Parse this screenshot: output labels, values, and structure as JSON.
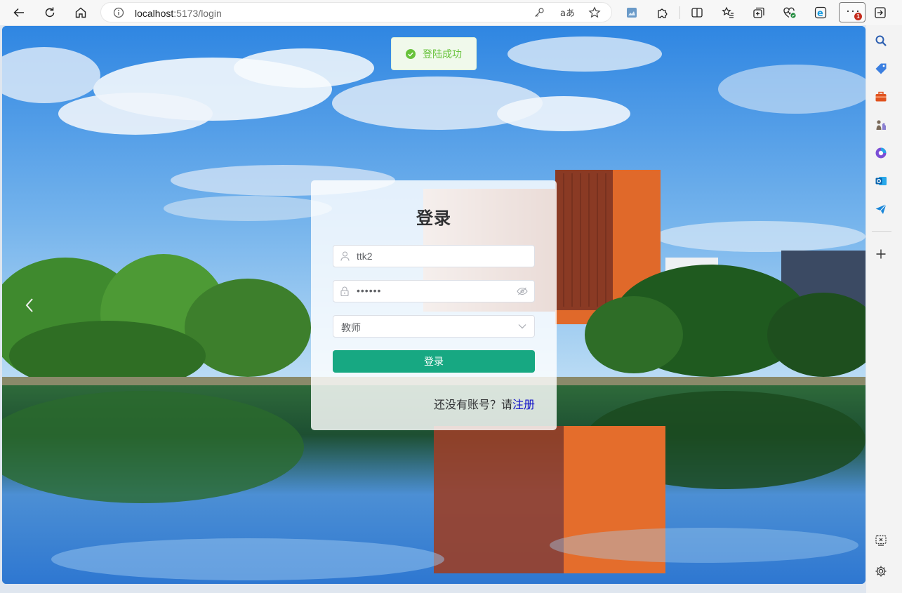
{
  "browser": {
    "url_host": "localhost",
    "url_rest": ":5173/login",
    "more_button": "···",
    "notification_count": "1"
  },
  "page": {
    "toast": {
      "message": "登陆成功",
      "icon": "success-check-icon"
    },
    "login": {
      "title": "登录",
      "username_value": "ttk2",
      "password_value": "••••••",
      "role_value": "教师",
      "submit_label": "登录",
      "register_prompt": "还没有账号？请",
      "register_link": "注册"
    }
  },
  "colors": {
    "accent": "#17a882",
    "toast_text": "#67c23a",
    "link": "#1010c8"
  }
}
